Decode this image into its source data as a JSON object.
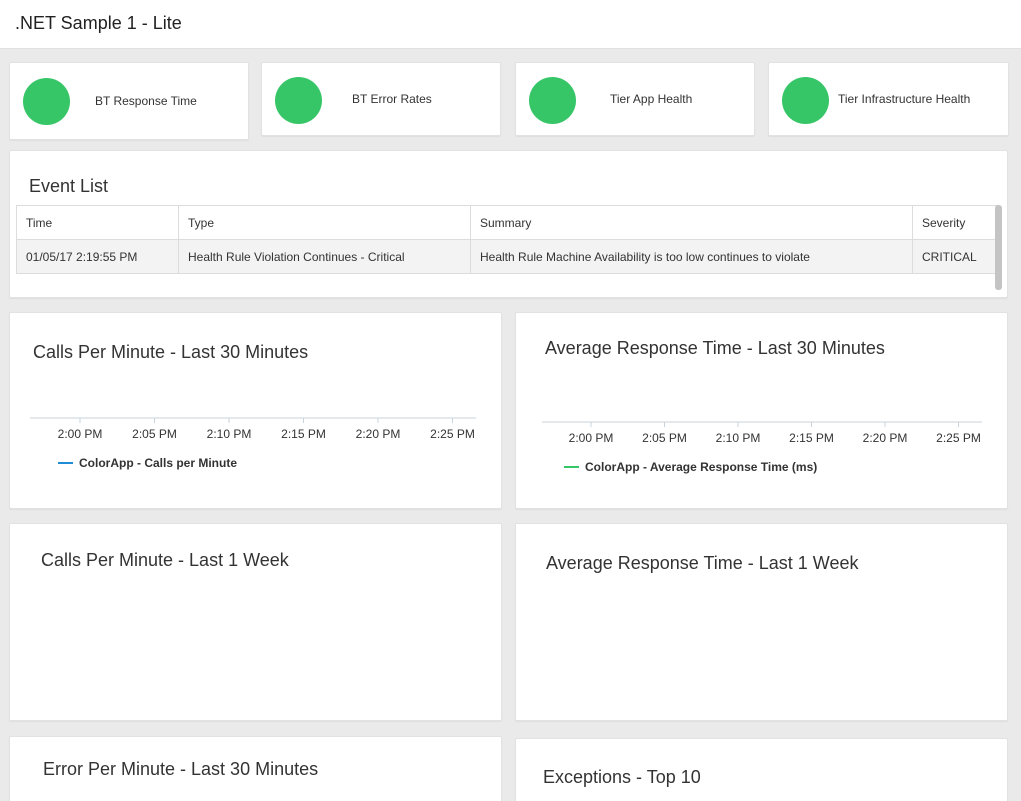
{
  "header": {
    "title": ".NET Sample 1 - Lite"
  },
  "status_cards": [
    {
      "label": "BT Response Time",
      "status_color": "#36c667"
    },
    {
      "label": "BT Error Rates",
      "status_color": "#36c667"
    },
    {
      "label": "Tier App Health",
      "status_color": "#36c667"
    },
    {
      "label": "Tier Infrastructure Health",
      "status_color": "#36c667"
    }
  ],
  "event_list": {
    "title": "Event List",
    "columns": [
      "Time",
      "Type",
      "Summary",
      "Severity"
    ],
    "rows": [
      {
        "time": "01/05/17 2:19:55 PM",
        "type": "Health Rule Violation Continues - Critical",
        "summary": "Health Rule Machine Availability is too low continues to violate",
        "severity": "CRITICAL"
      }
    ]
  },
  "widgets": {
    "calls_30": {
      "title": "Calls Per Minute - Last 30 Minutes"
    },
    "art_30": {
      "title": "Average Response Time - Last 30 Minutes"
    },
    "calls_week": {
      "title": "Calls Per Minute - Last 1 Week"
    },
    "art_week": {
      "title": "Average Response Time - Last 1 Week"
    },
    "errors_30": {
      "title": "Error Per Minute - Last 30 Minutes"
    },
    "exceptions": {
      "title": "Exceptions - Top 10"
    }
  },
  "chart_data": [
    {
      "type": "line",
      "title": "Calls Per Minute - Last 30 Minutes",
      "x_ticks": [
        "2:00 PM",
        "2:05 PM",
        "2:10 PM",
        "2:15 PM",
        "2:20 PM",
        "2:25 PM"
      ],
      "series": [
        {
          "name": "ColorApp - Calls per Minute",
          "color": "#1f8dd6",
          "values": []
        }
      ],
      "legend": "bottom-left"
    },
    {
      "type": "line",
      "title": "Average Response Time - Last 30 Minutes",
      "x_ticks": [
        "2:00 PM",
        "2:05 PM",
        "2:10 PM",
        "2:15 PM",
        "2:20 PM",
        "2:25 PM"
      ],
      "series": [
        {
          "name": "ColorApp - Average Response Time (ms)",
          "color": "#36c667",
          "values": []
        }
      ],
      "legend": "bottom-left"
    }
  ]
}
